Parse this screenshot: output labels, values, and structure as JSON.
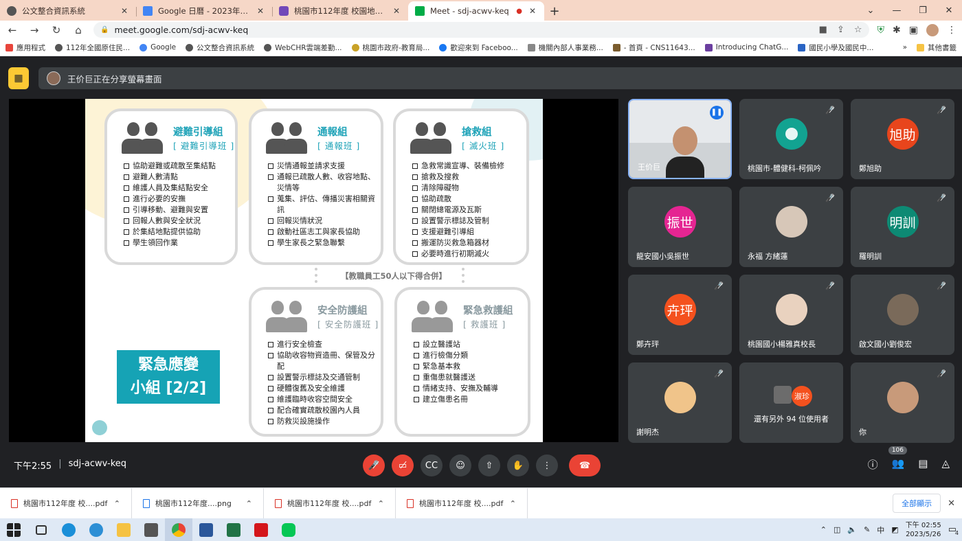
{
  "browser": {
    "tabs": [
      {
        "title": "公文整合資訊系統",
        "active": false,
        "favicon_color": "#555555"
      },
      {
        "title": "Google 日曆 - 2023年6月5日當...",
        "active": false,
        "favicon_color": "#4285f4"
      },
      {
        "title": "桃園市112年度 校園地震災害防...",
        "active": false,
        "favicon_color": "#7248b9"
      },
      {
        "title": "Meet - sdj-acwv-keq",
        "active": true,
        "favicon_color": "#00ac47"
      }
    ],
    "url": "meet.google.com/sdj-acwv-keq",
    "bookmarks": [
      "應用程式",
      "112年全國原住民...",
      "Google",
      "公文整合資訊系統",
      "WebCHR雲端差勤...",
      "桃園市政府-教育局...",
      "歡迎來到 Faceboo...",
      "機關內部人事業務...",
      "- 首頁 - CNS11643...",
      "Introducing ChatG...",
      "國民小學及國民中..."
    ],
    "bookmarks_more": "»",
    "other_bookmarks": "其他書籤"
  },
  "meet": {
    "presenting_text": "王价巨正在分享螢幕畫面",
    "time": "下午2:55",
    "meeting_code": "sdj-acwv-keq",
    "participant_count": "106",
    "slide": {
      "cards": [
        {
          "title": "避難引導組",
          "subtitle": "[ 避難引導班 ]",
          "items": [
            "協助避難或疏散至集結點",
            "避難人數清點",
            "維護人員及集結點安全",
            "進行必要的安撫",
            "引導移動、避難與安置",
            "回報人數與安全狀況",
            "於集結地點提供協助",
            "學生領回作業"
          ]
        },
        {
          "title": "通報組",
          "subtitle": "[ 通報班 ]",
          "items": [
            "災情通報並請求支援",
            "通報已疏散人數、收容地點、災情等",
            "蒐集、評估、傳播災害相關資訊",
            "回報災情狀況",
            "啟動社區志工與家長協助",
            "學生家長之緊急聯繫"
          ]
        },
        {
          "title": "搶救組",
          "subtitle": "[ 滅火班 ]",
          "items": [
            "急救常識宣導、裝備檢修",
            "搶救及搜救",
            "清除障礙物",
            "協助疏散",
            "關閉總電源及瓦斯",
            "設置警示標誌及管制",
            "支援避難引導組",
            "搬運防災救急箱器材",
            "必要時進行初期滅火"
          ]
        },
        {
          "title": "安全防護組",
          "subtitle": "[ 安全防護班 ]",
          "items": [
            "進行安全檢查",
            "協助收容物資造冊、保管及分配",
            "設置警示標誌及交通管制",
            "硬體復舊及安全維護",
            "維護臨時收容空間安全",
            "配合確實疏散校園內人員",
            "防救災設施操作"
          ]
        },
        {
          "title": "緊急救護組",
          "subtitle": "[ 救護班 ]",
          "items": [
            "設立醫護站",
            "進行檢傷分類",
            "緊急基本救",
            "重傷患就醫護送",
            "情緒支持、安撫及輔導",
            "建立傷患名冊"
          ]
        }
      ],
      "caption": "【教職員工50人以下得合併】",
      "label_line1": "緊急應變",
      "label_line2": "小組 [2/2]"
    },
    "participants": [
      {
        "name": "王价巨",
        "type": "video",
        "speaking": true
      },
      {
        "name": "桃園市-體健科-柯佩吟",
        "type": "avatar",
        "initials": "",
        "color": "#12a391"
      },
      {
        "name": "鄭旭助",
        "type": "avatar",
        "initials": "旭助",
        "color": "#e8451c"
      },
      {
        "name": "龍安國小吳振世",
        "type": "avatar",
        "initials": "振世",
        "color": "#e52592"
      },
      {
        "name": "永福 方緒蓮",
        "type": "photo",
        "initials": "",
        "color": "#d7c7b8"
      },
      {
        "name": "羅明訓",
        "type": "avatar",
        "initials": "明訓",
        "color": "#0d8a74"
      },
      {
        "name": "鄭卉玶",
        "type": "avatar",
        "initials": "卉玶",
        "color": "#f4511e"
      },
      {
        "name": "桃園國小楊雅真校長",
        "type": "photo",
        "initials": "",
        "color": "#e9d2bf"
      },
      {
        "name": "啟文國小劉俊宏",
        "type": "photo",
        "initials": "",
        "color": "#7a6a5a"
      },
      {
        "name": "謝明杰",
        "type": "photo",
        "initials": "",
        "color": "#f0c48a"
      },
      {
        "name": "還有另外 94 位使用者",
        "type": "more",
        "initials": "淑珍",
        "color": "#f4511e"
      },
      {
        "name": "你",
        "type": "photo",
        "initials": "",
        "color": "#c89a7a"
      }
    ]
  },
  "downloads": {
    "items": [
      {
        "name": "桃園市112年度 校....pdf",
        "kind": "pdf"
      },
      {
        "name": "桃園市112年度....png",
        "kind": "png"
      },
      {
        "name": "桃園市112年度 校....pdf",
        "kind": "pdf"
      },
      {
        "name": "桃園市112年度 校....pdf",
        "kind": "pdf"
      }
    ],
    "show_all": "全部顯示"
  },
  "taskbar": {
    "time": "下午 02:55",
    "date": "2023/5/26",
    "ime": "中",
    "notifications": "4"
  }
}
